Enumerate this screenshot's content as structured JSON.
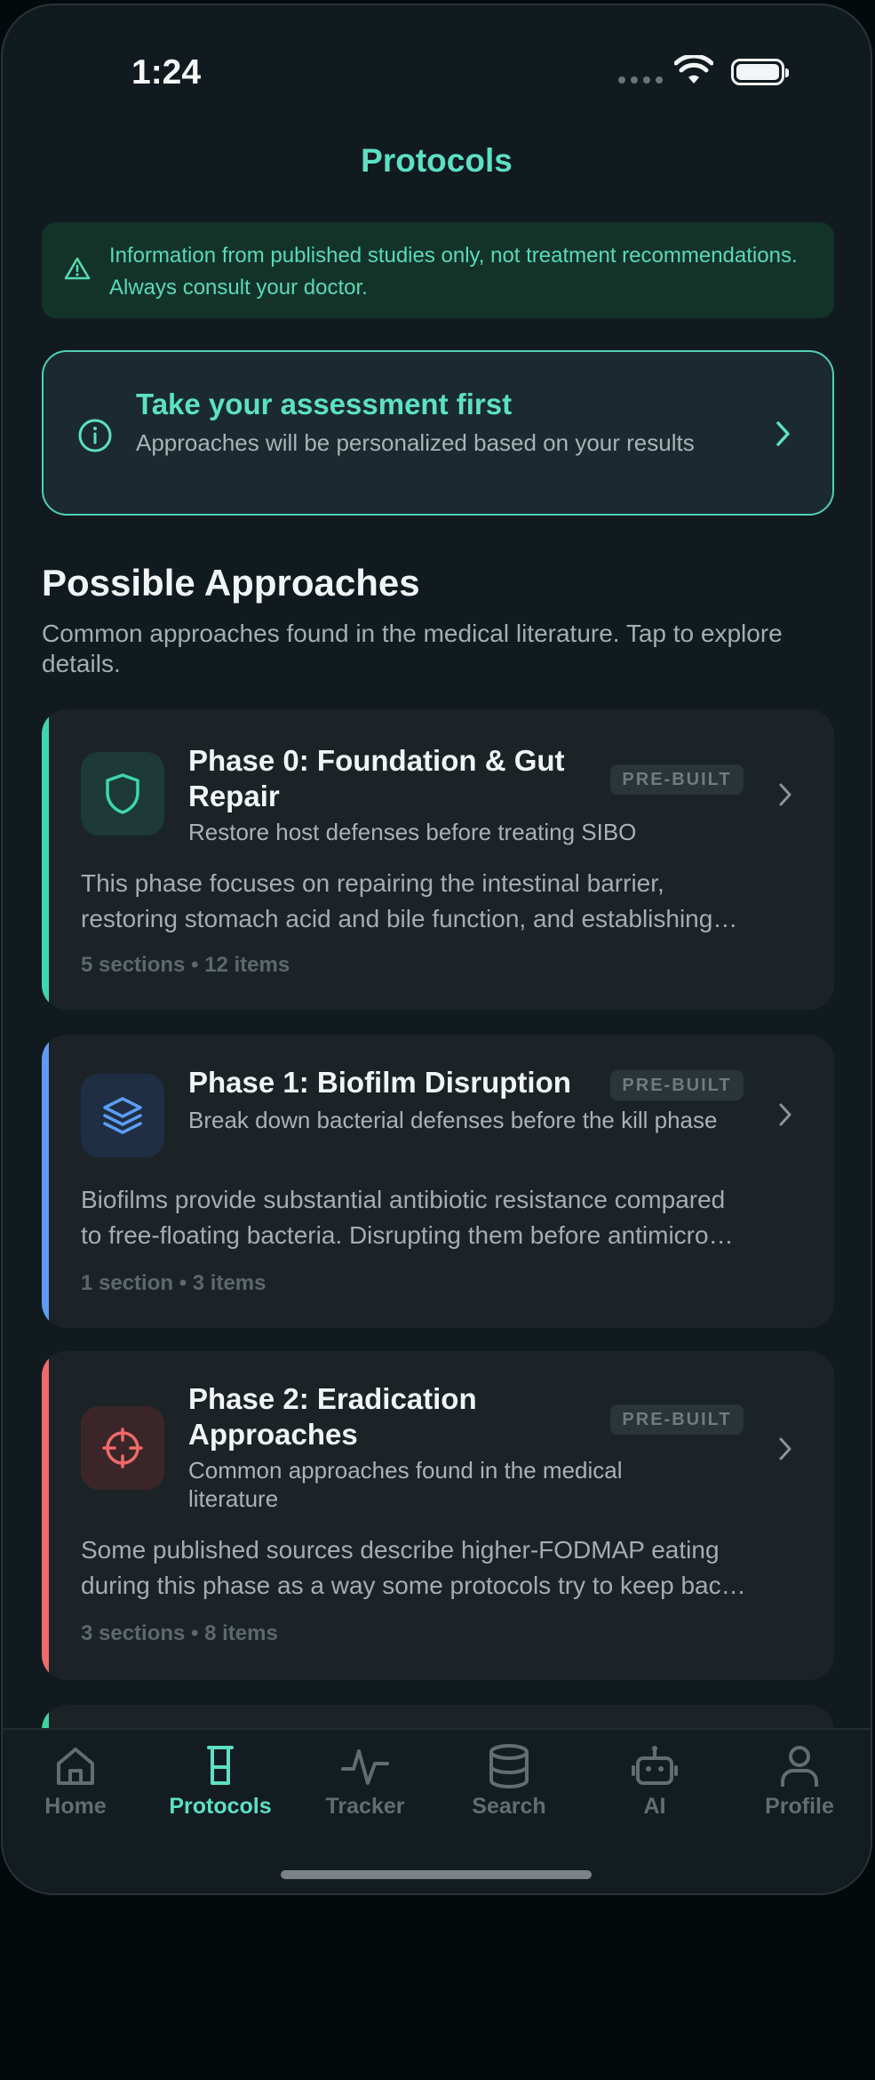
{
  "status_bar": {
    "time": "1:24"
  },
  "header": {
    "title": "Protocols"
  },
  "disclaimer": {
    "text": "Information from published studies only, not treatment recommendations. Always consult your doctor."
  },
  "assessment": {
    "title": "Take your assessment first",
    "subtitle": "Approaches will be personalized based on your results"
  },
  "section": {
    "title": "Possible Approaches",
    "subtitle": "Common approaches found in the medical literature. Tap to explore details."
  },
  "colors": {
    "accent_teal": "#5de0c3",
    "phase0": "#3dd6b0",
    "phase1": "#5b9cf5",
    "phase2": "#f06a6a",
    "phase3": "#3dd6a0"
  },
  "cards": [
    {
      "title": "Phase 0: Foundation & Gut Repair",
      "subtitle": "Restore host defenses before treating SIBO",
      "badge": "PRE-BUILT",
      "icon": "shield-icon",
      "desc_line1": "This phase focuses on repairing the intestinal barrier,",
      "desc_line2": "restoring stomach acid and bile function, and establishing…",
      "meta": "5 sections • 12 items"
    },
    {
      "title": "Phase 1: Biofilm Disruption",
      "subtitle": "Break down bacterial defenses before the kill phase",
      "badge": "PRE-BUILT",
      "icon": "layers-icon",
      "desc_line1": "Biofilms provide substantial antibiotic resistance compared",
      "desc_line2": "to free-floating bacteria. Disrupting them before antimicro…",
      "meta": "1 section • 3 items"
    },
    {
      "title": "Phase 2: Eradication Approaches",
      "subtitle": "Common approaches found in the medical literature",
      "badge": "PRE-BUILT",
      "icon": "crosshair-icon",
      "desc_line1": "Some published sources describe higher-FODMAP eating",
      "desc_line2": "during this phase as a way some protocols try to keep bac…",
      "meta": "3 sections • 8 items"
    }
  ],
  "tabs": [
    {
      "label": "Home",
      "icon": "home-icon",
      "active": false
    },
    {
      "label": "Protocols",
      "icon": "beaker-icon",
      "active": true
    },
    {
      "label": "Tracker",
      "icon": "activity-icon",
      "active": false
    },
    {
      "label": "Search",
      "icon": "database-icon",
      "active": false
    },
    {
      "label": "AI",
      "icon": "robot-icon",
      "active": false
    },
    {
      "label": "Profile",
      "icon": "user-icon",
      "active": false
    }
  ]
}
